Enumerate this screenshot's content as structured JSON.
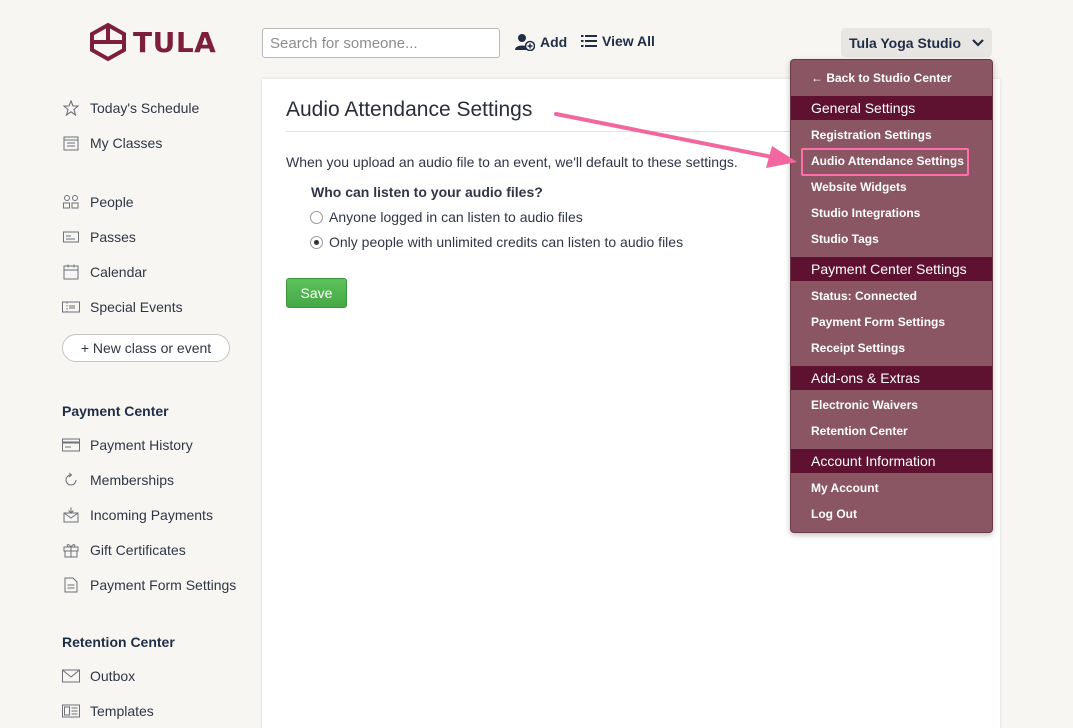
{
  "header": {
    "logo_text": "TULA",
    "search_placeholder": "Search for someone...",
    "add_label": "Add",
    "view_all_label": "View All",
    "studio_label": "Tula Yoga Studio"
  },
  "sidebar": {
    "main_items": [
      {
        "label": "Today's Schedule",
        "icon": "star-icon"
      },
      {
        "label": "My Classes",
        "icon": "calendar-list-icon"
      },
      {
        "label": "People",
        "icon": "people-icon"
      },
      {
        "label": "Passes",
        "icon": "pass-card-icon"
      },
      {
        "label": "Calendar",
        "icon": "calendar-icon"
      },
      {
        "label": "Special Events",
        "icon": "ticket-icon"
      }
    ],
    "new_class_label": "+ New class or event",
    "payment_center": {
      "heading": "Payment Center",
      "items": [
        {
          "label": "Payment History",
          "icon": "credit-card-icon"
        },
        {
          "label": "Memberships",
          "icon": "refresh-icon"
        },
        {
          "label": "Incoming Payments",
          "icon": "inbox-icon"
        },
        {
          "label": "Gift Certificates",
          "icon": "gift-icon"
        },
        {
          "label": "Payment Form Settings",
          "icon": "document-icon"
        }
      ]
    },
    "retention_center": {
      "heading": "Retention Center",
      "items": [
        {
          "label": "Outbox",
          "icon": "envelope-icon"
        },
        {
          "label": "Templates",
          "icon": "template-icon"
        }
      ]
    }
  },
  "main": {
    "title": "Audio Attendance Settings",
    "intro": "When you upload an audio file to an event, we'll default to these settings.",
    "question": "Who can listen to your audio files?",
    "options": [
      {
        "label": "Anyone logged in can listen to audio files",
        "selected": false
      },
      {
        "label": "Only people with unlimited credits can listen to audio files",
        "selected": true
      }
    ],
    "save_label": "Save"
  },
  "menu": {
    "back_label": "← Back to Studio Center",
    "general_heading": "General Settings",
    "general_items": [
      "Registration Settings",
      "Audio Attendance Settings",
      "Website Widgets",
      "Studio Integrations",
      "Studio Tags"
    ],
    "payment_heading": "Payment Center Settings",
    "payment_items": [
      "Status: Connected",
      "Payment Form Settings",
      "Receipt Settings"
    ],
    "addons_heading": "Add-ons & Extras",
    "addons_items": [
      "Electronic Waivers",
      "Retention Center"
    ],
    "account_heading": "Account Information",
    "account_items": [
      "My Account",
      "Log Out"
    ]
  },
  "colors": {
    "brand": "#7d1f3c",
    "menu_bg": "#8a5663",
    "menu_heading_bg": "#5f1130",
    "highlight": "#ff6eaa",
    "save_green": "#4fb64f"
  }
}
